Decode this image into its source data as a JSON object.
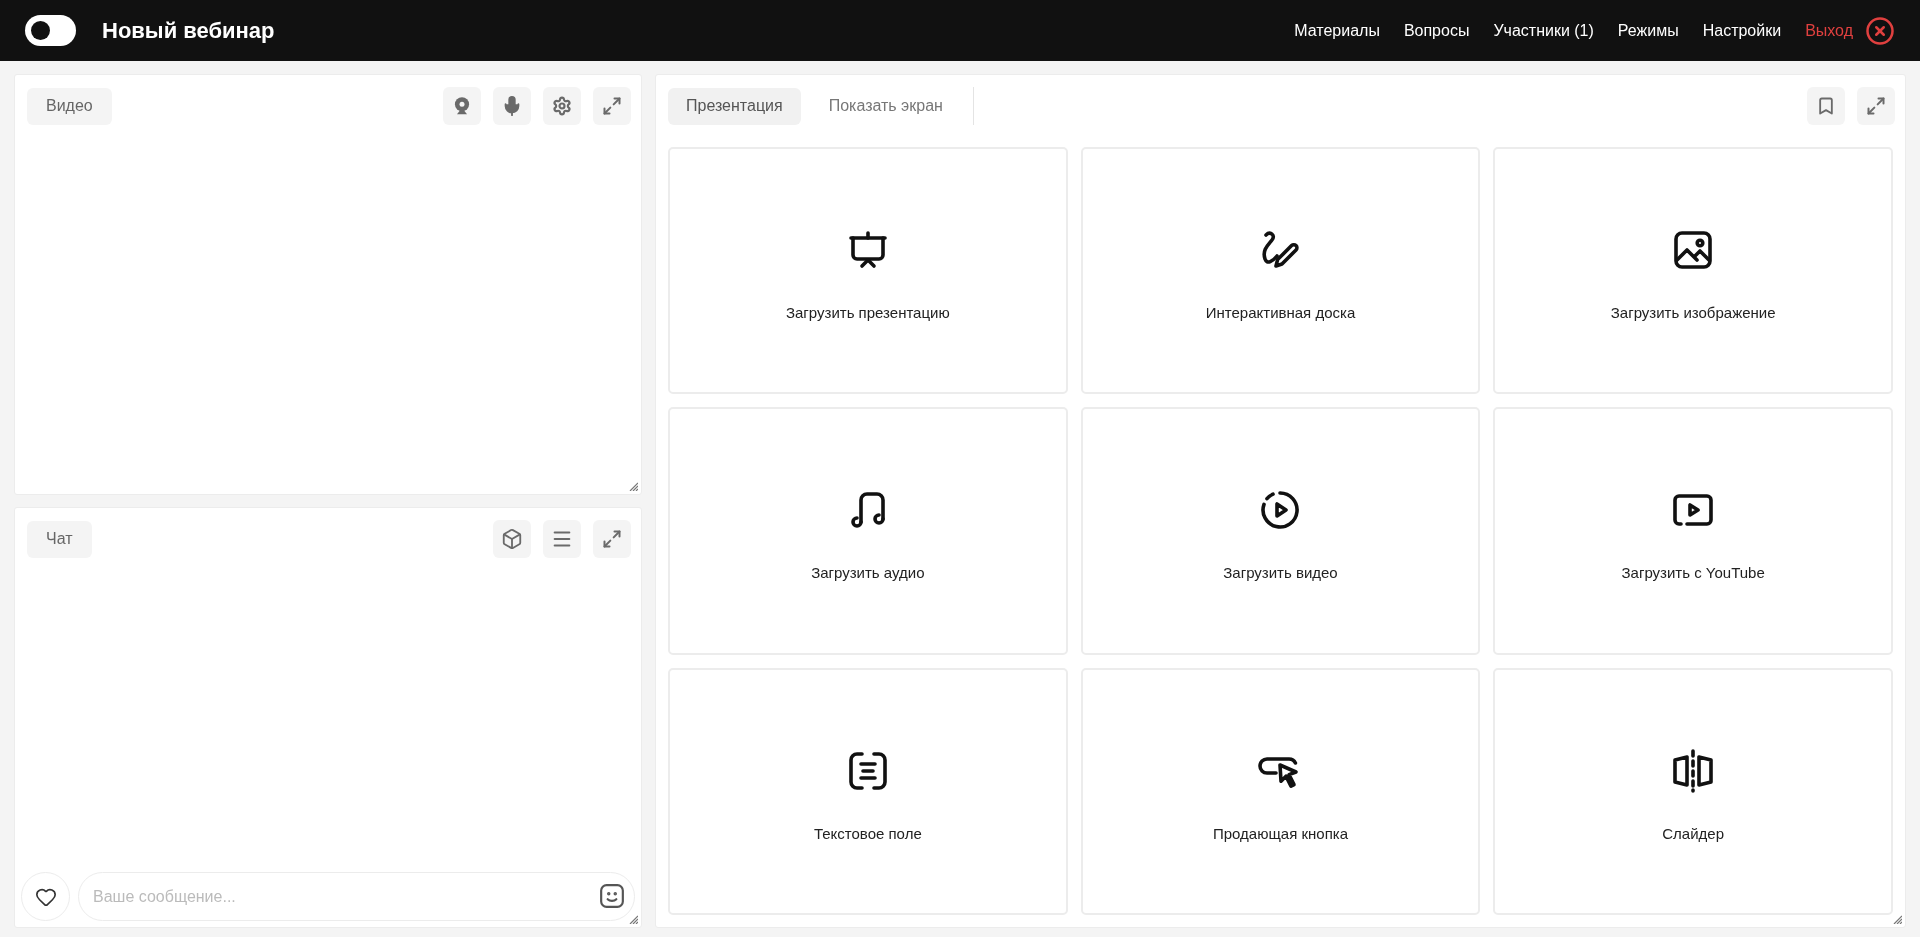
{
  "header": {
    "switch": {
      "on": false
    },
    "title": "Новый вебинар",
    "nav": [
      {
        "label": "Материалы",
        "kind": "link"
      },
      {
        "label": "Вопросы",
        "kind": "link"
      },
      {
        "label": "Участники (1)",
        "kind": "link"
      },
      {
        "label": "Режимы",
        "kind": "link"
      },
      {
        "label": "Настройки",
        "kind": "link"
      },
      {
        "label": "Выход",
        "kind": "exit"
      }
    ]
  },
  "video_panel": {
    "title": "Видео"
  },
  "chat_panel": {
    "title": "Чат",
    "message_field": {
      "placeholder": "Ваше сообщение..."
    }
  },
  "presentation_panel": {
    "tabs": [
      {
        "label": "Презентация",
        "selected": true
      },
      {
        "label": "Показать экран",
        "selected": false
      }
    ],
    "tiles": [
      {
        "label": "Загрузить презентацию",
        "kind": "presentation"
      },
      {
        "label": "Интерактивная доска",
        "kind": "whiteboard"
      },
      {
        "label": "Загрузить изображение",
        "kind": "image"
      },
      {
        "label": "Загрузить аудио",
        "kind": "audio"
      },
      {
        "label": "Загрузить видео",
        "kind": "video"
      },
      {
        "label": "Загрузить с YouTube",
        "kind": "youtube"
      },
      {
        "label": "Текстовое поле",
        "kind": "text"
      },
      {
        "label": "Продающая кнопка",
        "kind": "button"
      },
      {
        "label": "Слайдер",
        "kind": "slider"
      }
    ]
  }
}
